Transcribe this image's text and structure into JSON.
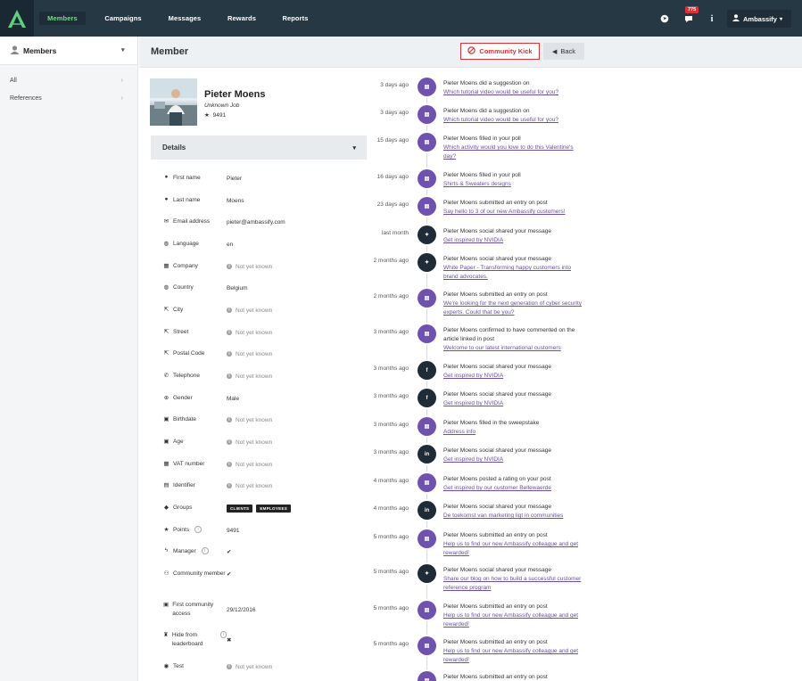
{
  "nav": {
    "items": [
      "Members",
      "Campaigns",
      "Messages",
      "Rewards",
      "Reports"
    ],
    "badge_count": "775",
    "user_name": "Ambassify"
  },
  "sidebar": {
    "title": "Members",
    "items": [
      {
        "label": "All"
      },
      {
        "label": "References"
      }
    ]
  },
  "header": {
    "title": "Member",
    "kick_label": "Community Kick",
    "back_label": "Back"
  },
  "profile": {
    "name": "Pieter Moens",
    "job": "Unknown Job",
    "points": "9491"
  },
  "details": {
    "title": "Details",
    "rows": [
      {
        "label": "First name",
        "value": "Pieter",
        "icon": "user-icon"
      },
      {
        "label": "Last name",
        "value": "Moens",
        "icon": "user-icon"
      },
      {
        "label": "Email address",
        "value": "pieter@ambassify.com",
        "icon": "envelope-icon"
      },
      {
        "label": "Language",
        "value": "en",
        "icon": "globe-icon"
      },
      {
        "label": "Company",
        "value": "Not yet known",
        "icon": "building-icon"
      },
      {
        "label": "Country",
        "value": "Belgium",
        "icon": "globe-icon"
      },
      {
        "label": "City",
        "value": "Not yet known",
        "icon": "signpost-icon"
      },
      {
        "label": "Street",
        "value": "Not yet known",
        "icon": "signpost-icon"
      },
      {
        "label": "Postal Code",
        "value": "Not yet known",
        "icon": "signpost-icon"
      },
      {
        "label": "Telephone",
        "value": "Not yet known",
        "icon": "phone-icon"
      },
      {
        "label": "Gender",
        "value": "Male",
        "icon": "gender-icon"
      },
      {
        "label": "Birthdate",
        "value": "Not yet known",
        "icon": "calendar-icon"
      },
      {
        "label": "Age",
        "value": "Not yet known",
        "icon": "calendar-icon"
      },
      {
        "label": "VAT number",
        "value": "Not yet known",
        "icon": "building-icon"
      },
      {
        "label": "Identifier",
        "value": "Not yet known",
        "icon": "id-card-icon"
      },
      {
        "label": "Groups",
        "value": "",
        "icon": "tag-icon"
      },
      {
        "label": "Points",
        "value": "9491",
        "icon": "star-icon"
      },
      {
        "label": "Manager",
        "value": "✔",
        "icon": "bolt-icon"
      },
      {
        "label": "Community member",
        "value": "✔",
        "icon": "users-icon"
      },
      {
        "label": "First community access",
        "value": "29/12/2016",
        "icon": "calendar-icon"
      },
      {
        "label": "Hide from leaderboard",
        "value": "✖",
        "icon": "trophy-icon"
      },
      {
        "label": "Test",
        "value": "Not yet known",
        "icon": "circle-icon"
      }
    ],
    "groups": [
      "CLIENTS",
      "EMPLOYEES"
    ]
  },
  "activity": [
    {
      "time": "3 days ago",
      "text": "Pieter Moens did a suggestion on",
      "link": "Which tutorial video would be useful for you?",
      "icon": "post-icon"
    },
    {
      "time": "3 days ago",
      "text": "Pieter Moens did a suggestion on",
      "link": "Which tutorial video would be useful for you?",
      "icon": "post-icon"
    },
    {
      "time": "15 days ago",
      "text": "Pieter Moens filled in your poll",
      "link": "Which activity would you love to do this Valentine's day?",
      "icon": "post-icon"
    },
    {
      "time": "16 days ago",
      "text": "Pieter Moens filled in your poll",
      "link": "Shirts & Sweaters designs",
      "icon": "post-icon"
    },
    {
      "time": "23 days ago",
      "text": "Pieter Moens submitted an entry on post",
      "link": "Say hello to 3 of our new Ambassify customers!",
      "icon": "post-icon"
    },
    {
      "time": "last month",
      "text": "Pieter Moens social shared your message",
      "link": "Get inspired by NVIDIA",
      "icon": "twitter-icon"
    },
    {
      "time": "2 months ago",
      "text": "Pieter Moens social shared your message",
      "link": "White Paper - Transforming happy customers into brand advocates.",
      "icon": "twitter-icon"
    },
    {
      "time": "2 months ago",
      "text": "Pieter Moens submitted an entry on post",
      "link": "We're looking for the next generation of cyber security experts. Could that be you?",
      "icon": "post-icon"
    },
    {
      "time": "3 months ago",
      "text": "Pieter Moens confirmed to have commented on the article linked in post",
      "link": "Welcome to our latest international customers",
      "icon": "post-icon"
    },
    {
      "time": "3 months ago",
      "text": "Pieter Moens social shared your message",
      "link": "Get inspired by NVIDIA",
      "icon": "facebook-icon"
    },
    {
      "time": "3 months ago",
      "text": "Pieter Moens social shared your message",
      "link": "Get inspired by NVIDIA",
      "icon": "facebook-icon"
    },
    {
      "time": "3 months ago",
      "text": "Pieter Moens filled in the sweepstake",
      "link": "Address info",
      "icon": "post-icon"
    },
    {
      "time": "3 months ago",
      "text": "Pieter Moens social shared your message",
      "link": "Get inspired by NVIDIA",
      "icon": "linkedin-icon"
    },
    {
      "time": "4 months ago",
      "text": "Pieter Moens posted a rating on your post",
      "link": "Get inspired by our customer Bellewaerde",
      "icon": "post-icon"
    },
    {
      "time": "4 months ago",
      "text": "Pieter Moens social shared your message",
      "link": "De toekomst van marketing ligt in communities",
      "icon": "linkedin-icon"
    },
    {
      "time": "5 months ago",
      "text": "Pieter Moens submitted an entry on post",
      "link": "Help us to find our new Ambassify colleague and get rewarded!",
      "icon": "post-icon"
    },
    {
      "time": "5 months ago",
      "text": "Pieter Moens social shared your message",
      "link": "Share our blog on how to build a successful customer reference program",
      "icon": "twitter-icon"
    },
    {
      "time": "5 months ago",
      "text": "Pieter Moens submitted an entry on post",
      "link": "Help us to find our new Ambassify colleague and get rewarded!",
      "icon": "post-icon"
    },
    {
      "time": "5 months ago",
      "text": "Pieter Moens submitted an entry on post",
      "link": "Help us to find our new Ambassify colleague and get rewarded!",
      "icon": "post-icon"
    },
    {
      "time": "",
      "text": "Pieter Moens submitted an entry on post",
      "link": "",
      "icon": "post-icon"
    }
  ]
}
